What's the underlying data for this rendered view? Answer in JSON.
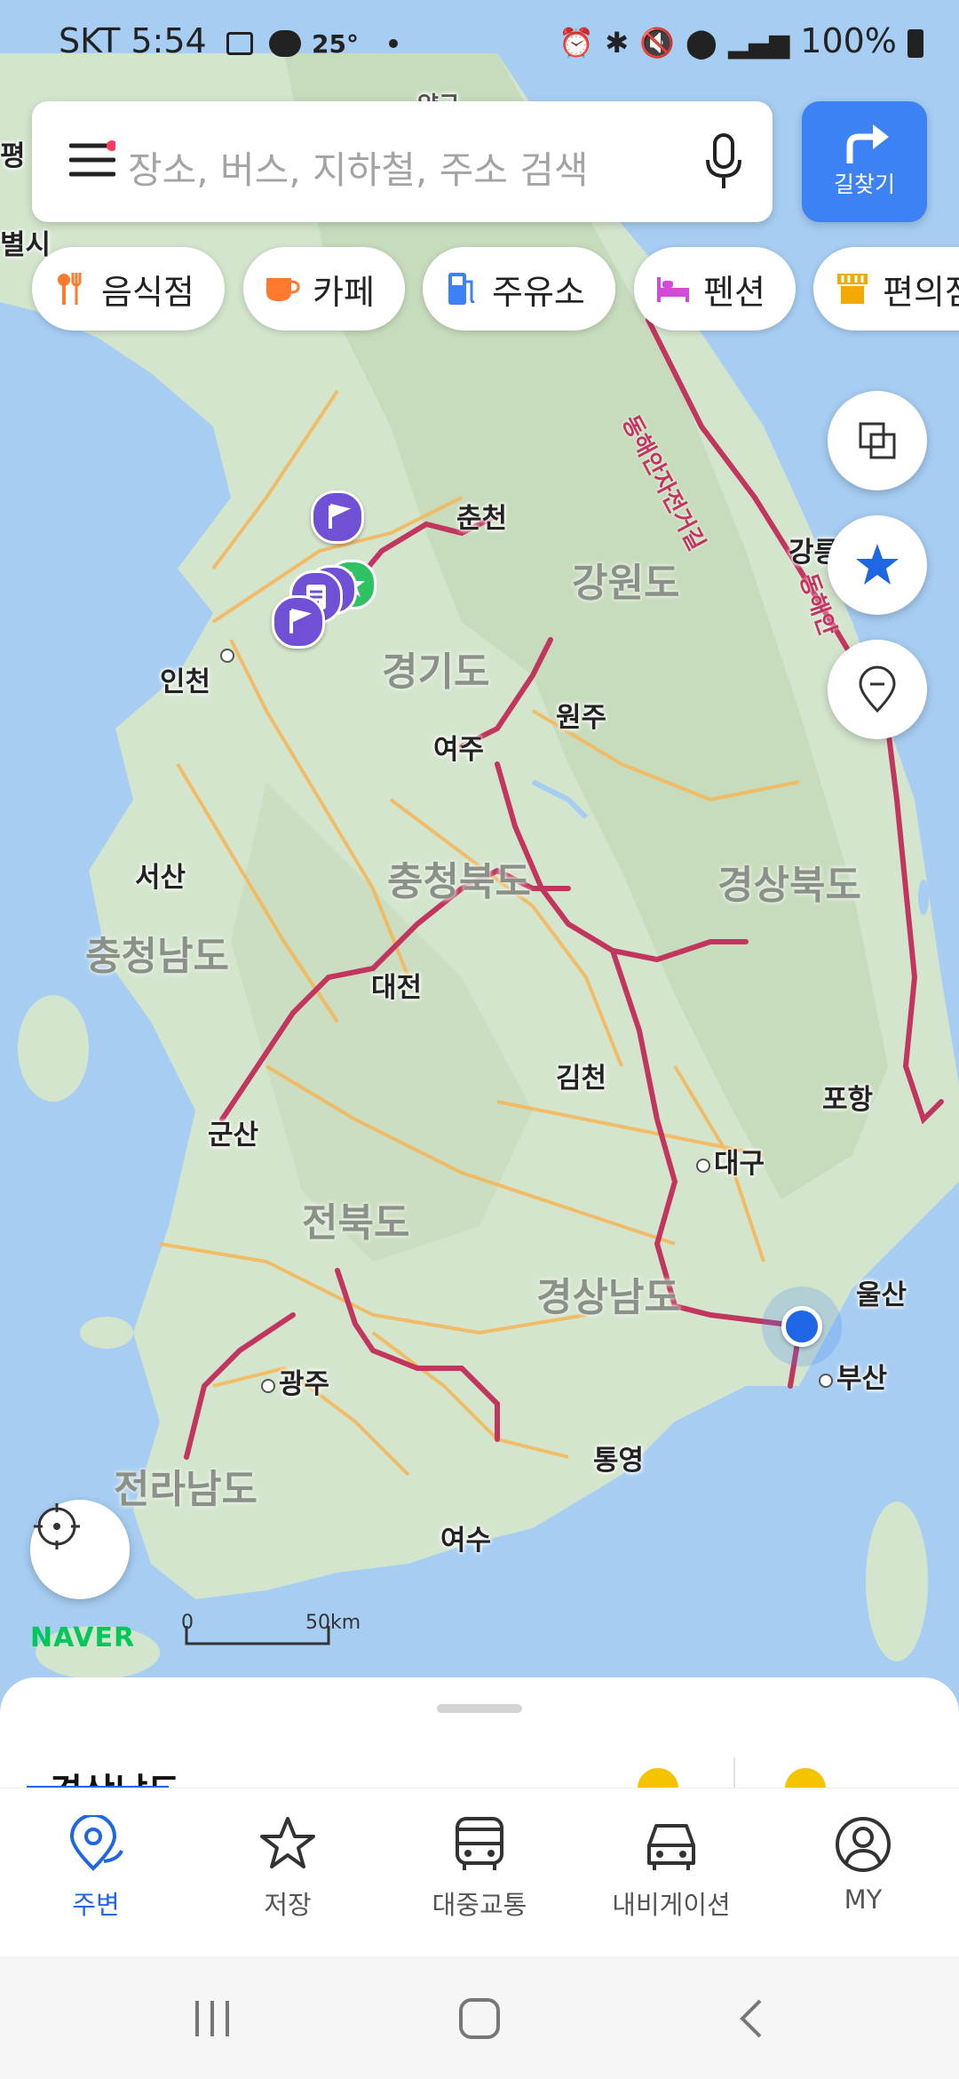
{
  "status_bar": {
    "carrier_time": "SKT 5:54",
    "temp": "25°",
    "battery": "100%"
  },
  "search": {
    "placeholder": "장소, 버스, 지하철, 주소 검색",
    "route_label": "길찾기"
  },
  "chips": [
    {
      "label": "음식점",
      "icon": "fork-knife-icon",
      "color": "#ff7a2f"
    },
    {
      "label": "카페",
      "icon": "coffee-cup-icon",
      "color": "#ff7a2f"
    },
    {
      "label": "주유소",
      "icon": "gas-station-icon",
      "color": "#3d82f4"
    },
    {
      "label": "펜션",
      "icon": "bed-icon",
      "color": "#d24bd6"
    },
    {
      "label": "편의점",
      "icon": "store-icon",
      "color": "#f2a900"
    }
  ],
  "map": {
    "edge_labels": {
      "top_left": "평",
      "mid_left": "별시",
      "top_center": "양구"
    },
    "places": [
      "춘천",
      "인천",
      "원주",
      "여주",
      "서산",
      "대전",
      "김천",
      "포항",
      "대구",
      "군산",
      "울산",
      "광주",
      "부산",
      "통영",
      "여수",
      "강릉"
    ],
    "regions": [
      "강원도",
      "경기도",
      "충청북도",
      "경상북도",
      "충청남도",
      "전북도",
      "경상남도",
      "전라남도"
    ],
    "highway_label": "동해안자전거길",
    "highway_label_2": "동해안",
    "scale": {
      "zero": "0",
      "distance": "50km"
    },
    "brand": "NAVER"
  },
  "sheet": {
    "peek_title": "경상남도"
  },
  "nav": [
    {
      "label": "주변",
      "icon": "location-pin-icon",
      "active": true
    },
    {
      "label": "저장",
      "icon": "star-icon",
      "active": false
    },
    {
      "label": "대중교통",
      "icon": "bus-icon",
      "active": false
    },
    {
      "label": "내비게이션",
      "icon": "car-icon",
      "active": false
    },
    {
      "label": "MY",
      "icon": "user-circle-icon",
      "active": false
    }
  ],
  "colors": {
    "accent": "#3d82f4",
    "road": "#c2355f",
    "minor_road": "#f5b85c",
    "land": "#d7e6cf",
    "sea": "#a7cdf2"
  }
}
